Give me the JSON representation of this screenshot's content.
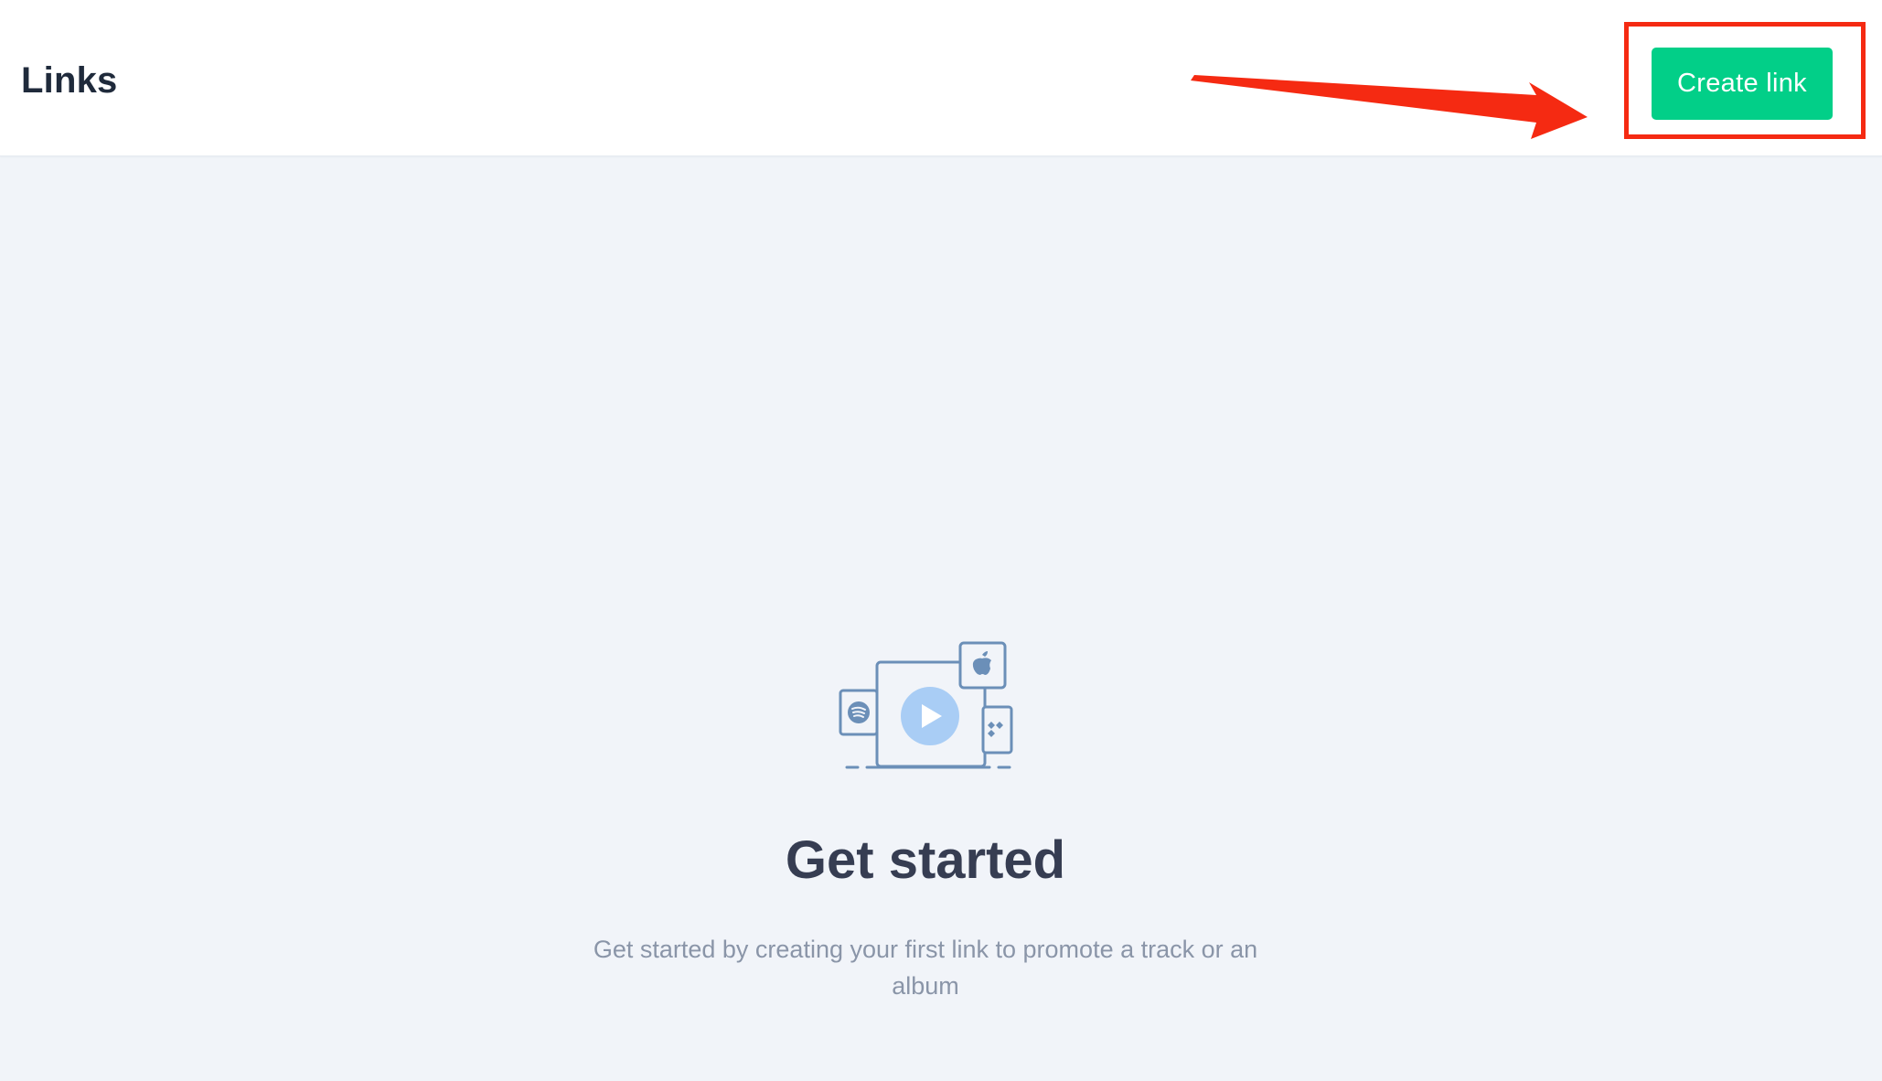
{
  "header": {
    "title": "Links",
    "create_button_label": "Create link"
  },
  "empty_state": {
    "title": "Get started",
    "description": "Get started by creating your first link to promote a track or an album"
  },
  "colors": {
    "page_background": "#f1f4f9",
    "header_background": "#ffffff",
    "button_background": "#02cf88",
    "annotation_red": "#f52a12",
    "illustration_stroke": "#6b8fb8",
    "play_circle": "#a9cdf5"
  }
}
